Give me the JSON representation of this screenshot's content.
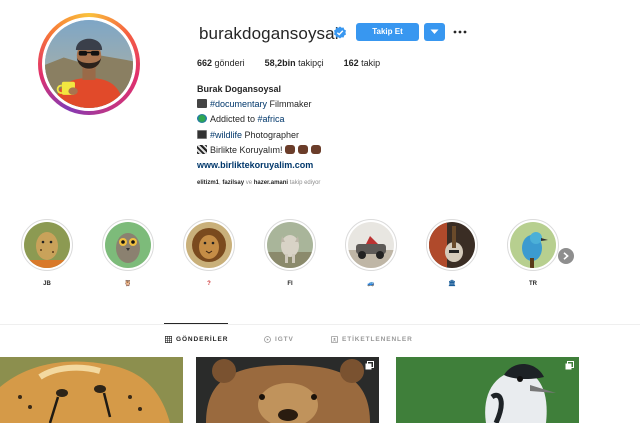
{
  "profile": {
    "username": "burakdogansoysal",
    "verified": true,
    "follow_label": "Takip Et",
    "stats": [
      {
        "value": "662",
        "label": "gönderi"
      },
      {
        "value": "58,2bin",
        "label": "takipçi"
      },
      {
        "value": "162",
        "label": "takip"
      }
    ],
    "full_name": "Burak Dogansoysal",
    "bio": {
      "line1_tag": "#documentary",
      "line1_text": " Filmmaker",
      "line2_text": "Addicted to ",
      "line2_tag": "#africa",
      "line3_tag": "#wildlife",
      "line3_text": " Photographer",
      "line4_text": "Birlikte Koruyalım! ",
      "website": "www.birliktekoruyalim.com"
    },
    "followed_by": {
      "user1": "elitizm1",
      "sep": ", ",
      "user2": "fazilsay",
      "mid": " ve ",
      "user3": "hazer.amani",
      "suffix": " takip ediyor"
    }
  },
  "highlights": [
    {
      "label": "JB",
      "icon": "cheetah-photo"
    },
    {
      "label": "🦉",
      "icon": "owl-photo"
    },
    {
      "label": "?",
      "icon": "lion-photo"
    },
    {
      "label": "FI",
      "icon": "wolf-photo"
    },
    {
      "label": "🚙",
      "icon": "car-photo"
    },
    {
      "label": "🏛",
      "icon": "guitar-photo"
    },
    {
      "label": "TR",
      "icon": "bird-photo"
    }
  ],
  "tabs": [
    {
      "label": "GÖNDERİLER",
      "icon": "grid-icon",
      "active": true
    },
    {
      "label": "IGTV",
      "icon": "igtv-icon",
      "active": false
    },
    {
      "label": "ETİKETLENENLER",
      "icon": "tag-icon",
      "active": false
    }
  ],
  "posts": [
    {
      "subject": "cheetah"
    },
    {
      "subject": "bear"
    },
    {
      "subject": "bird"
    }
  ],
  "colors": {
    "accent": "#3897f0",
    "link": "#00376b",
    "muted": "#8e8e8e",
    "text": "#262626"
  }
}
